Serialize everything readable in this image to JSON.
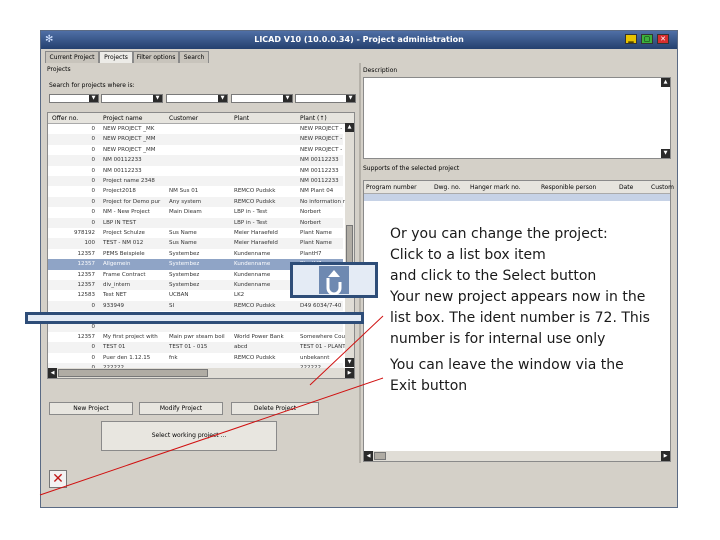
{
  "window": {
    "title": "LICAD V10 (10.0.0.34) - Project administration"
  },
  "tabs": [
    "Current Project",
    "Projects",
    "Filter options",
    "Search"
  ],
  "projects_section": {
    "label": "Projects",
    "search_label": "Search for projects where is:"
  },
  "table": {
    "columns": [
      "Offer no.",
      "Project name",
      "Customer",
      "Plant",
      "Plant (↑)"
    ],
    "rows": [
      [
        "0",
        "NEW PROJECT _MK",
        "",
        "",
        "NEW PROJECT -"
      ],
      [
        "0",
        "NEW PROJECT _MM",
        "",
        "",
        "NEW PROJECT -"
      ],
      [
        "0",
        "NEW PROJECT _MM",
        "",
        "",
        "NEW PROJECT -"
      ],
      [
        "0",
        "NM 00112233",
        "",
        "",
        "NM 00112233"
      ],
      [
        "0",
        "NM 00112233",
        "",
        "",
        "NM 00112233"
      ],
      [
        "0",
        "Project name 2348",
        "",
        "",
        "NM 00112233"
      ],
      [
        "0",
        "Project2018",
        "NM Sus 01",
        "REMCO Pudskk",
        "NM Plant 04"
      ],
      [
        "0",
        "Project for Demo pur",
        "Any system",
        "REMCO Pudskk",
        "No information re"
      ],
      [
        "0",
        "NM - New Project",
        "Main Dieam",
        "LBP in - Test",
        "Norbert"
      ],
      [
        "0",
        "LBP IN TEST",
        "",
        "LBP in - Test",
        "Norbert"
      ],
      [
        "978192",
        "Project Schulze",
        "Sus Name",
        "Meier Haraefeld",
        "Plant Name"
      ],
      [
        "100",
        "TEST - NM 012",
        "Sus Name",
        "Meier Haraefeld",
        "Plant Name"
      ],
      [
        "12357",
        "PEMS Beispiele",
        "Systembez",
        "Kundenname",
        "PlantH7"
      ],
      [
        "12357",
        "Allgemein",
        "Systembez",
        "Kundenname",
        "PlantH7"
      ],
      [
        "12357",
        "Frame Contract",
        "Systembez",
        "Kundenname",
        "PlantH7"
      ],
      [
        "12357",
        "div_intern",
        "Systembez",
        "Kundenname",
        "PlantH7"
      ],
      [
        "12583",
        "Test NET",
        "UCBAN",
        "LK2",
        ""
      ],
      [
        "0",
        "933949",
        "SI",
        "REMCO Pudskk",
        "D49 6034/7-40"
      ],
      [
        "0",
        "",
        "",
        "",
        ""
      ],
      [
        "0",
        "",
        "",
        "",
        ""
      ],
      [
        "12357",
        "My first project with",
        "Main pwr steam boil",
        "World Power Bank",
        "Somewhere Cou"
      ],
      [
        "0",
        "TEST 01",
        "TEST 01 - 015",
        "abcd",
        "TEST 01 - PLANT"
      ],
      [
        "0",
        "Puer den 1.12.15",
        "fnk",
        "REMCO Pudskk",
        "unbekannt"
      ],
      [
        "0",
        "222222",
        "",
        "",
        "222222"
      ]
    ],
    "selected_row": 13
  },
  "buttons": {
    "new_project": "New Project",
    "modify_project": "Modify Project",
    "delete_project": "Delete Project",
    "select_working_project": "Select working project ..."
  },
  "description_section": {
    "label": "Description"
  },
  "supports_section": {
    "label": "Supports of the selected project",
    "columns": [
      "Program number",
      "Dwg. no.",
      "Hanger mark no.",
      "Responible person",
      "Date",
      "Custom"
    ]
  },
  "instructions": {
    "line1": "Or you can change the project:",
    "line2": "Click to a list box item",
    "line3": "and click to the Select button",
    "line4": "Your new project appears now in the",
    "line5": "list box. The ident number is 72. This",
    "line6": "number is for internal use only",
    "line7": "You can leave the window via the",
    "line8": "Exit button"
  },
  "colors": {
    "accent": "#8fa4c6",
    "titlebar": "#2c4a7c",
    "annotation_line": "#d01010"
  }
}
